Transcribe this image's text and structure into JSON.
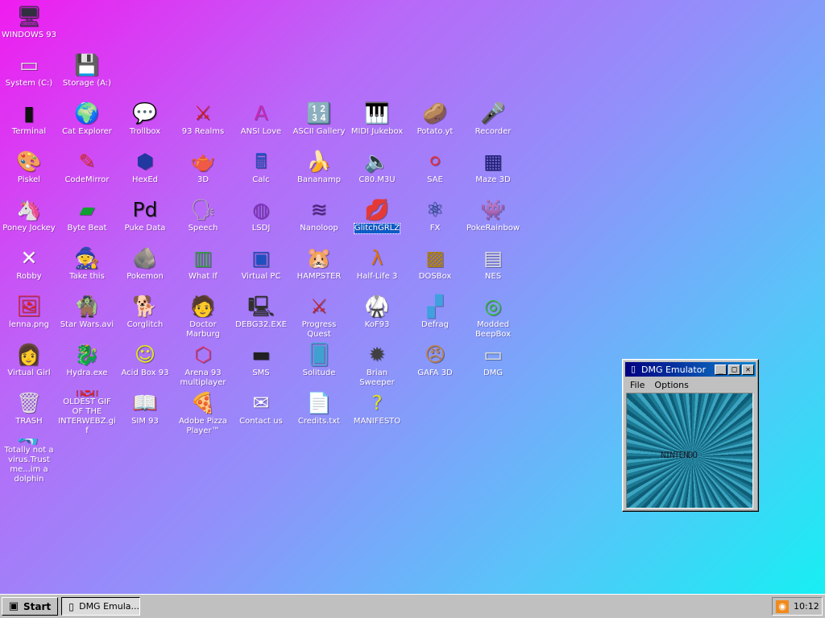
{
  "desktop": {
    "icons": [
      {
        "label": "WINDOWS 93",
        "glyph": "🖥",
        "color": "#303040",
        "name": "windows-93-icon"
      },
      {
        "label": "System (C:)",
        "glyph": "▭",
        "color": "#e0e0e0",
        "name": "drive-icon"
      },
      {
        "label": "Storage (A:)",
        "glyph": "💾",
        "color": "#e0e0e0",
        "name": "floppy-drive-icon"
      },
      {
        "label": "Terminal",
        "glyph": "▮",
        "color": "#101010",
        "name": "terminal-icon"
      },
      {
        "label": "Cat Explorer",
        "glyph": "🌍",
        "color": "#2d7fd8",
        "name": "cat-explorer-icon"
      },
      {
        "label": "Trollbox",
        "glyph": "💬",
        "color": "#58c7f2",
        "name": "trollbox-icon"
      },
      {
        "label": "93 Realms",
        "glyph": "⚔",
        "color": "#c81a1a",
        "name": "realms-icon"
      },
      {
        "label": "ANSI Love",
        "glyph": "A",
        "color": "#c82ab8",
        "name": "ansi-love-icon"
      },
      {
        "label": "ASCII Gallery",
        "glyph": "🔢",
        "color": "#1a9ab8",
        "name": "ascii-gallery-icon"
      },
      {
        "label": "MIDI Jukebox",
        "glyph": "🎹",
        "color": "#202020",
        "name": "midi-jukebox-icon"
      },
      {
        "label": "Potato.yt",
        "glyph": "🥔",
        "color": "#c89040",
        "name": "potato-icon"
      },
      {
        "label": "Recorder",
        "glyph": "🎤",
        "color": "#505050",
        "name": "recorder-icon"
      },
      {
        "label": "Piskel",
        "glyph": "🎨",
        "color": "#e0b050",
        "name": "piskel-icon"
      },
      {
        "label": "CodeMirror",
        "glyph": "✎",
        "color": "#e03030",
        "name": "codemirror-icon"
      },
      {
        "label": "HexEd",
        "glyph": "⬢",
        "color": "#2038a0",
        "name": "hexed-icon"
      },
      {
        "label": "3D",
        "glyph": "🫖",
        "color": "#e8a8b0",
        "name": "teapot-icon"
      },
      {
        "label": "Calc",
        "glyph": "🖩",
        "color": "#2050c0",
        "name": "calculator-icon"
      },
      {
        "label": "Bananamp",
        "glyph": "🍌",
        "color": "#f0e040",
        "name": "banana-icon"
      },
      {
        "label": "C80.M3U",
        "glyph": "🔈",
        "color": "#e0e0e0",
        "name": "playlist-icon"
      },
      {
        "label": "SAE",
        "glyph": "⚪",
        "color": "#e03040",
        "name": "sae-icon"
      },
      {
        "label": "Maze 3D",
        "glyph": "▦",
        "color": "#202080",
        "name": "maze-icon"
      },
      {
        "label": "Poney Jockey",
        "glyph": "🦄",
        "color": "#a050d0",
        "name": "poney-icon"
      },
      {
        "label": "Byte Beat",
        "glyph": "▰",
        "color": "#10a030",
        "name": "bytebeat-icon"
      },
      {
        "label": "Puke Data",
        "glyph": "Pd",
        "color": "#101010",
        "name": "puredata-icon"
      },
      {
        "label": "Speech",
        "glyph": "🗣",
        "color": "#b0b0b0",
        "name": "speech-icon"
      },
      {
        "label": "LSDJ",
        "glyph": "◍",
        "color": "#8030c0",
        "name": "lsdj-icon"
      },
      {
        "label": "Nanoloop",
        "glyph": "≋",
        "color": "#502080",
        "name": "nanoloop-icon"
      },
      {
        "label": "GlitchGRLZ",
        "glyph": "💋",
        "color": "#2060d0",
        "name": "glitchgrlz-icon"
      },
      {
        "label": "FX",
        "glyph": "⚛",
        "color": "#104080",
        "name": "fx-icon"
      },
      {
        "label": "PokeRainbow",
        "glyph": "👾",
        "color": "#303030",
        "name": "pokerainbow-icon"
      },
      {
        "label": "Robby",
        "glyph": "✕",
        "color": "#ffffff",
        "name": "robby-icon"
      },
      {
        "label": "Take this",
        "glyph": "🧙",
        "color": "#e06020",
        "name": "take-this-icon"
      },
      {
        "label": "Pokemon",
        "glyph": "🪨",
        "color": "#a06030",
        "name": "pokemon-icon"
      },
      {
        "label": "What If",
        "glyph": "▥",
        "color": "#30a040",
        "name": "what-if-icon"
      },
      {
        "label": "Virtual PC",
        "glyph": "▣",
        "color": "#2050c0",
        "name": "virtual-pc-icon"
      },
      {
        "label": "HAMPSTER",
        "glyph": "🐹",
        "color": "#e0e0e0",
        "name": "hampster-icon"
      },
      {
        "label": "Half-Life 3",
        "glyph": "λ",
        "color": "#e07010",
        "name": "half-life-icon"
      },
      {
        "label": "DOSBox",
        "glyph": "▩",
        "color": "#b08010",
        "name": "dosbox-icon"
      },
      {
        "label": "NES",
        "glyph": "▤",
        "color": "#e0e0e0",
        "name": "nes-icon"
      },
      {
        "label": "lenna.png",
        "glyph": "🖼",
        "color": "#e02020",
        "name": "lenna-icon"
      },
      {
        "label": "Star Wars.avi",
        "glyph": "🧌",
        "color": "#50a040",
        "name": "star-wars-icon"
      },
      {
        "label": "Corglitch",
        "glyph": "🐕",
        "color": "#e08040",
        "name": "corglitch-icon"
      },
      {
        "label": "Doctor Marburg",
        "glyph": "🧑",
        "color": "#e0a0a0",
        "name": "doctor-marburg-icon"
      },
      {
        "label": "DEBG32.EXE",
        "glyph": "🖳",
        "color": "#303030",
        "name": "debug-icon"
      },
      {
        "label": "Progress Quest",
        "glyph": "⚔",
        "color": "#c02020",
        "name": "progress-quest-icon"
      },
      {
        "label": "KoF93",
        "glyph": "🥋",
        "color": "#e0b080",
        "name": "kof-icon"
      },
      {
        "label": "Defrag",
        "glyph": "▞",
        "color": "#40a0e0",
        "name": "defrag-icon"
      },
      {
        "label": "Modded BeepBox",
        "glyph": "◎",
        "color": "#30c030",
        "name": "beepbox-icon"
      },
      {
        "label": "Virtual Girl",
        "glyph": "👩",
        "color": "#f0b0a0",
        "name": "virtual-girl-icon"
      },
      {
        "label": "Hydra.exe",
        "glyph": "🐉",
        "color": "#20a040",
        "name": "hydra-icon"
      },
      {
        "label": "Acid Box 93",
        "glyph": "☺",
        "color": "#e0f010",
        "name": "acid-box-icon"
      },
      {
        "label": "Arena 93 multiplayer",
        "glyph": "⬡",
        "color": "#e03060",
        "name": "arena-icon"
      },
      {
        "label": "SMS",
        "glyph": "▬",
        "color": "#202020",
        "name": "sms-icon"
      },
      {
        "label": "Solitude",
        "glyph": "🂠",
        "color": "#40a0d0",
        "name": "solitude-icon"
      },
      {
        "label": "Brian Sweeper",
        "glyph": "✹",
        "color": "#404040",
        "name": "brian-sweeper-icon"
      },
      {
        "label": "GAFA 3D",
        "glyph": "😠",
        "color": "#c08040",
        "name": "gafa-icon"
      },
      {
        "label": "DMG",
        "glyph": "▭",
        "color": "#e0e0e0",
        "name": "dmg-icon"
      },
      {
        "label": "TRASH",
        "glyph": "🗑",
        "color": "#e0e0e0",
        "name": "trash-icon"
      },
      {
        "label": "OLDEST GIF OF THE INTERWEBZ.gif",
        "glyph": "🖼",
        "color": "#e02020",
        "name": "oldest-gif-icon"
      },
      {
        "label": "SIM 93",
        "glyph": "📖",
        "color": "#e0e0e0",
        "name": "sim93-icon"
      },
      {
        "label": "Adobe Pizza Player™",
        "glyph": "🍕",
        "color": "#e0a040",
        "name": "pizza-player-icon"
      },
      {
        "label": "Contact us",
        "glyph": "✉",
        "color": "#ffffff",
        "name": "contact-us-icon"
      },
      {
        "label": "Credits.txt",
        "glyph": "📄",
        "color": "#ffffff",
        "name": "credits-icon"
      },
      {
        "label": "MANIFESTO",
        "glyph": "?",
        "color": "#e0e020",
        "name": "manifesto-icon"
      },
      {
        "label": "Totally not a virus.Trust me...im a dolphin",
        "glyph": "🐬",
        "color": "#60c0e0",
        "name": "dolphin-icon"
      }
    ]
  },
  "window": {
    "title": "DMG Emulator",
    "menu": [
      "File",
      "Options"
    ],
    "controls": {
      "minimize": "_",
      "maximize": "□",
      "close": "✕"
    },
    "screen_text": "NINTENDO"
  },
  "taskbar": {
    "start_label": "Start",
    "task_label": "DMG Emula...",
    "clock": "10:12"
  }
}
